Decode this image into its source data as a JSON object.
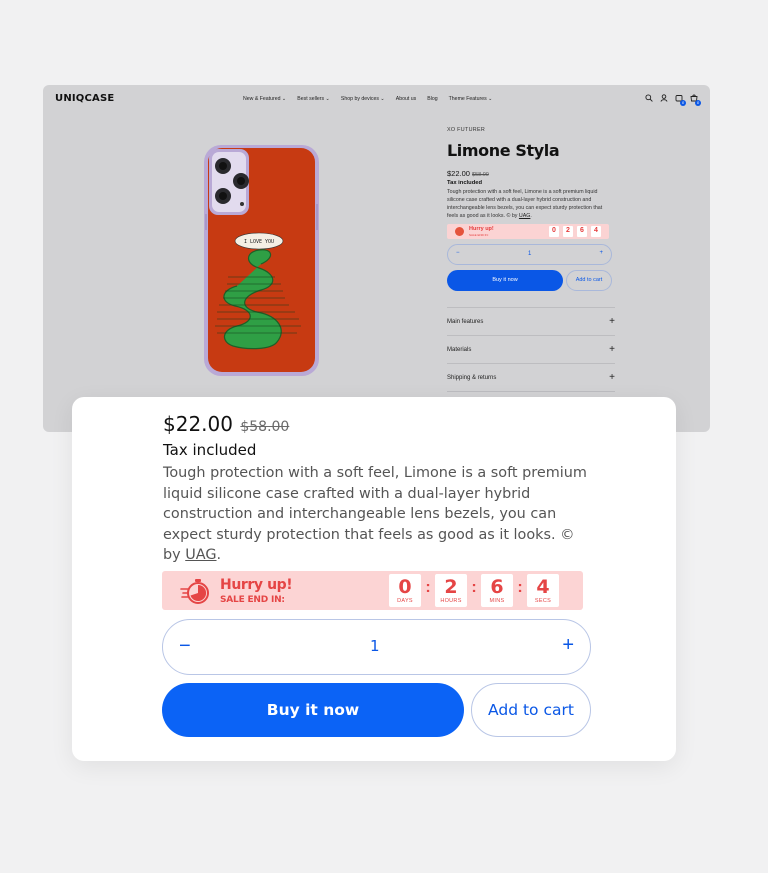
{
  "colors": {
    "accent": "#0b63f6",
    "sale_red": "#e54545",
    "sale_bg": "#fcd4d4",
    "phone_case": "#c73a12",
    "snake_green": "#2f9f45"
  },
  "store": {
    "logo": "UNIQCASE",
    "menu": [
      "New & Featured ⌄",
      "Best sellers ⌄",
      "Shop by devices ⌄",
      "About us",
      "Blog",
      "Theme Features ⌄"
    ],
    "icons": [
      "search-icon",
      "account-icon",
      "wishlist-icon",
      "cart-icon"
    ],
    "wishlist_count": "0",
    "cart_count": "0"
  },
  "product": {
    "vendor": "XO FUTURER",
    "title": "Limone Styla",
    "price": "$22.00",
    "compare_price": "$58.00",
    "tax": "Tax included",
    "description": "Tough protection with a soft feel, Limone is a soft premium liquid silicone case crafted with a dual-layer hybrid construction and interchangeable lens bezels, you can expect sturdy protection that feels as good as it looks. © by ",
    "brand_link": "UAG",
    "brand_suffix": ".",
    "phone_art": {
      "bubble_text": "I LOVE YOU"
    }
  },
  "countdown": {
    "title": "Hurry up!",
    "subtitle": "SALE END IN:",
    "days": "0",
    "days_label": "DAYS",
    "hours": "2",
    "hours_label": "HOURS",
    "mins": "6",
    "mins_label": "MINS",
    "secs": "4",
    "secs_label": "SECS"
  },
  "quantity": {
    "value": "1",
    "minus": "−",
    "plus": "+"
  },
  "buttons": {
    "buy_now": "Buy it now",
    "add_to_cart": "Add to cart"
  },
  "accordion": [
    {
      "label": "Main features",
      "icon": "+"
    },
    {
      "label": "Materials",
      "icon": "+"
    },
    {
      "label": "Shipping & returns",
      "icon": "+"
    }
  ]
}
